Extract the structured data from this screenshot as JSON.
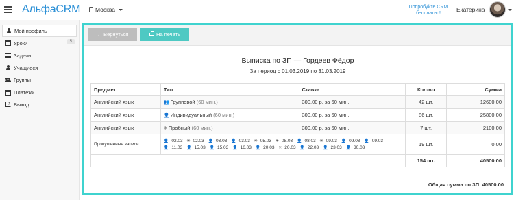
{
  "header": {
    "logo": "АльфаCRM",
    "city": "Москва",
    "promo": "Попробуйте CRM бесплатно!",
    "user_name": "Екатерина"
  },
  "sidebar": {
    "items": [
      {
        "label": "Мой профиль",
        "icon": "user-icon"
      },
      {
        "label": "Уроки",
        "icon": "calendar-icon",
        "badge": "5"
      },
      {
        "label": "Задачи",
        "icon": "list-icon"
      },
      {
        "label": "Учащиеся",
        "icon": "user-icon"
      },
      {
        "label": "Группы",
        "icon": "group-icon"
      },
      {
        "label": "Платежи",
        "icon": "payment-icon"
      },
      {
        "label": "Выход",
        "icon": "exit-icon"
      }
    ]
  },
  "toolbar": {
    "back_label": "← Вернуться",
    "print_label": "На печать"
  },
  "report": {
    "title": "Выписка по ЗП — Гордеев Фёдор",
    "period": "За период с 01.03.2019 по 31.03.2019",
    "columns": [
      "Предмет",
      "Тип",
      "Ставка",
      "Кол-во",
      "Сумма"
    ],
    "rows": [
      {
        "subject": "Английский язык",
        "type": "Групповой",
        "duration": "(60 мин.)",
        "rate": "300.00 р. за 60 мин.",
        "count": "42 шт.",
        "sum": "12600.00"
      },
      {
        "subject": "Английский язык",
        "type": "Индивидуальный",
        "duration": "(60 мин.)",
        "rate": "300.00 р. за 60 мин.",
        "count": "86 шт.",
        "sum": "25800.00"
      },
      {
        "subject": "Английский язык",
        "type": "Пробный",
        "duration": "(60 мин.)",
        "rate": "300.00 р. за 60 мин.",
        "count": "7 шт.",
        "sum": "2100.00"
      }
    ],
    "skipped": {
      "label": "Пропущенные записи",
      "count": "19 шт.",
      "sum": "0.00",
      "line1": [
        "02.03",
        "02.03",
        "03.03",
        "03.03",
        "05.03",
        "08.03",
        "08.03",
        "09.03",
        "09.03",
        "09.03"
      ],
      "line2": [
        "11.03",
        "15.03",
        "15.03",
        "16.03",
        "20.03",
        "20.03",
        "22.03",
        "23.03",
        "30.03"
      ]
    },
    "total_count": "154 шт.",
    "total_sum": "40500.00",
    "grand_total": "Общая сумма по ЗП: 40500.00"
  }
}
